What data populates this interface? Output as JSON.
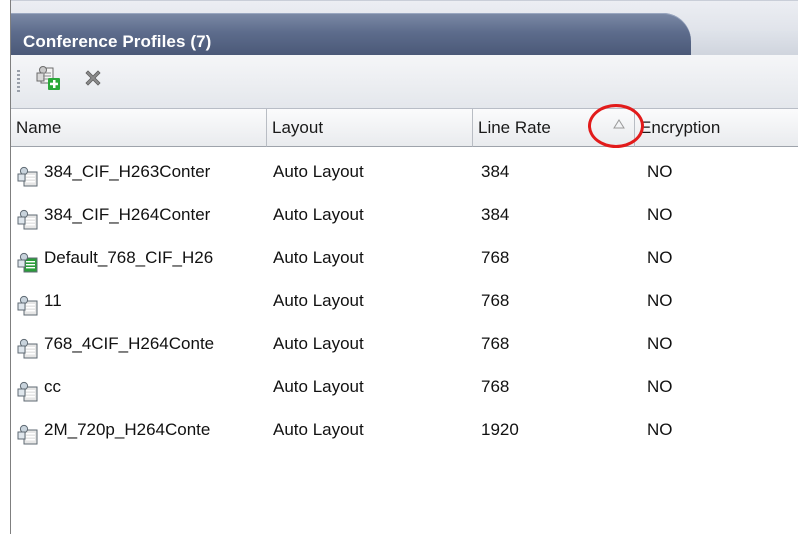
{
  "panel": {
    "title": "Conference Profiles (7)"
  },
  "toolbar": {
    "new_icon": "new-profile-icon",
    "delete_icon": "delete-icon"
  },
  "columns": {
    "name": "Name",
    "layout": "Layout",
    "line_rate": "Line Rate",
    "encryption": "Encryption",
    "sort_icon": "sort-ascending-icon"
  },
  "rows": [
    {
      "name": "384_CIF_H263Conter",
      "layout": "Auto Layout",
      "line_rate": "384",
      "encryption": "NO",
      "icon": "profile-icon"
    },
    {
      "name": "384_CIF_H264Conter",
      "layout": "Auto Layout",
      "line_rate": "384",
      "encryption": "NO",
      "icon": "profile-icon"
    },
    {
      "name": "Default_768_CIF_H26",
      "layout": "Auto Layout",
      "line_rate": "768",
      "encryption": "NO",
      "icon": "default-profile-icon"
    },
    {
      "name": "11",
      "layout": "Auto Layout",
      "line_rate": "768",
      "encryption": "NO",
      "icon": "profile-icon"
    },
    {
      "name": "768_4CIF_H264Conte",
      "layout": "Auto Layout",
      "line_rate": "768",
      "encryption": "NO",
      "icon": "profile-icon"
    },
    {
      "name": "cc",
      "layout": "Auto Layout",
      "line_rate": "768",
      "encryption": "NO",
      "icon": "profile-icon"
    },
    {
      "name": "2M_720p_H264Conte",
      "layout": "Auto Layout",
      "line_rate": "1920",
      "encryption": "NO",
      "icon": "profile-icon"
    }
  ],
  "colors": {
    "tab": "#5d6c8c",
    "highlight_circle": "#e21b1b",
    "default_marker": "#2a9d3a"
  }
}
